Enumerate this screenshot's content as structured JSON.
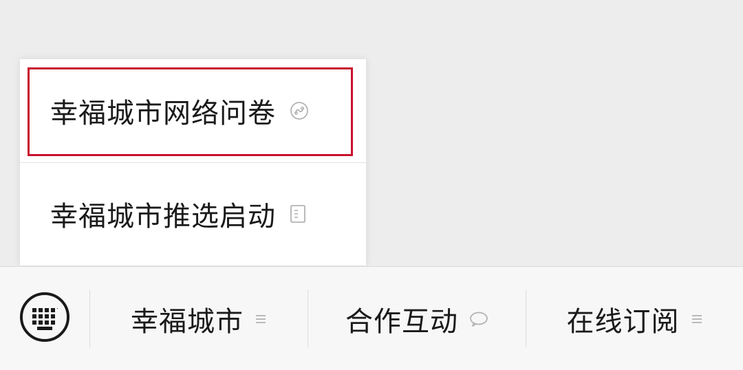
{
  "submenu": {
    "items": [
      {
        "label": "幸福城市网络问卷",
        "icon": "mini-program-icon",
        "highlighted": true
      },
      {
        "label": "幸福城市推选启动",
        "icon": "article-icon",
        "highlighted": false
      }
    ],
    "highlight_color": "#c8102e"
  },
  "bottom_bar": {
    "keyboard_icon": "keyboard-icon",
    "tabs": [
      {
        "label": "幸福城市",
        "icon": "submenu-lines-icon"
      },
      {
        "label": "合作互动",
        "icon": "chat-bubble-icon"
      },
      {
        "label": "在线订阅",
        "icon": "submenu-lines-icon"
      }
    ]
  }
}
